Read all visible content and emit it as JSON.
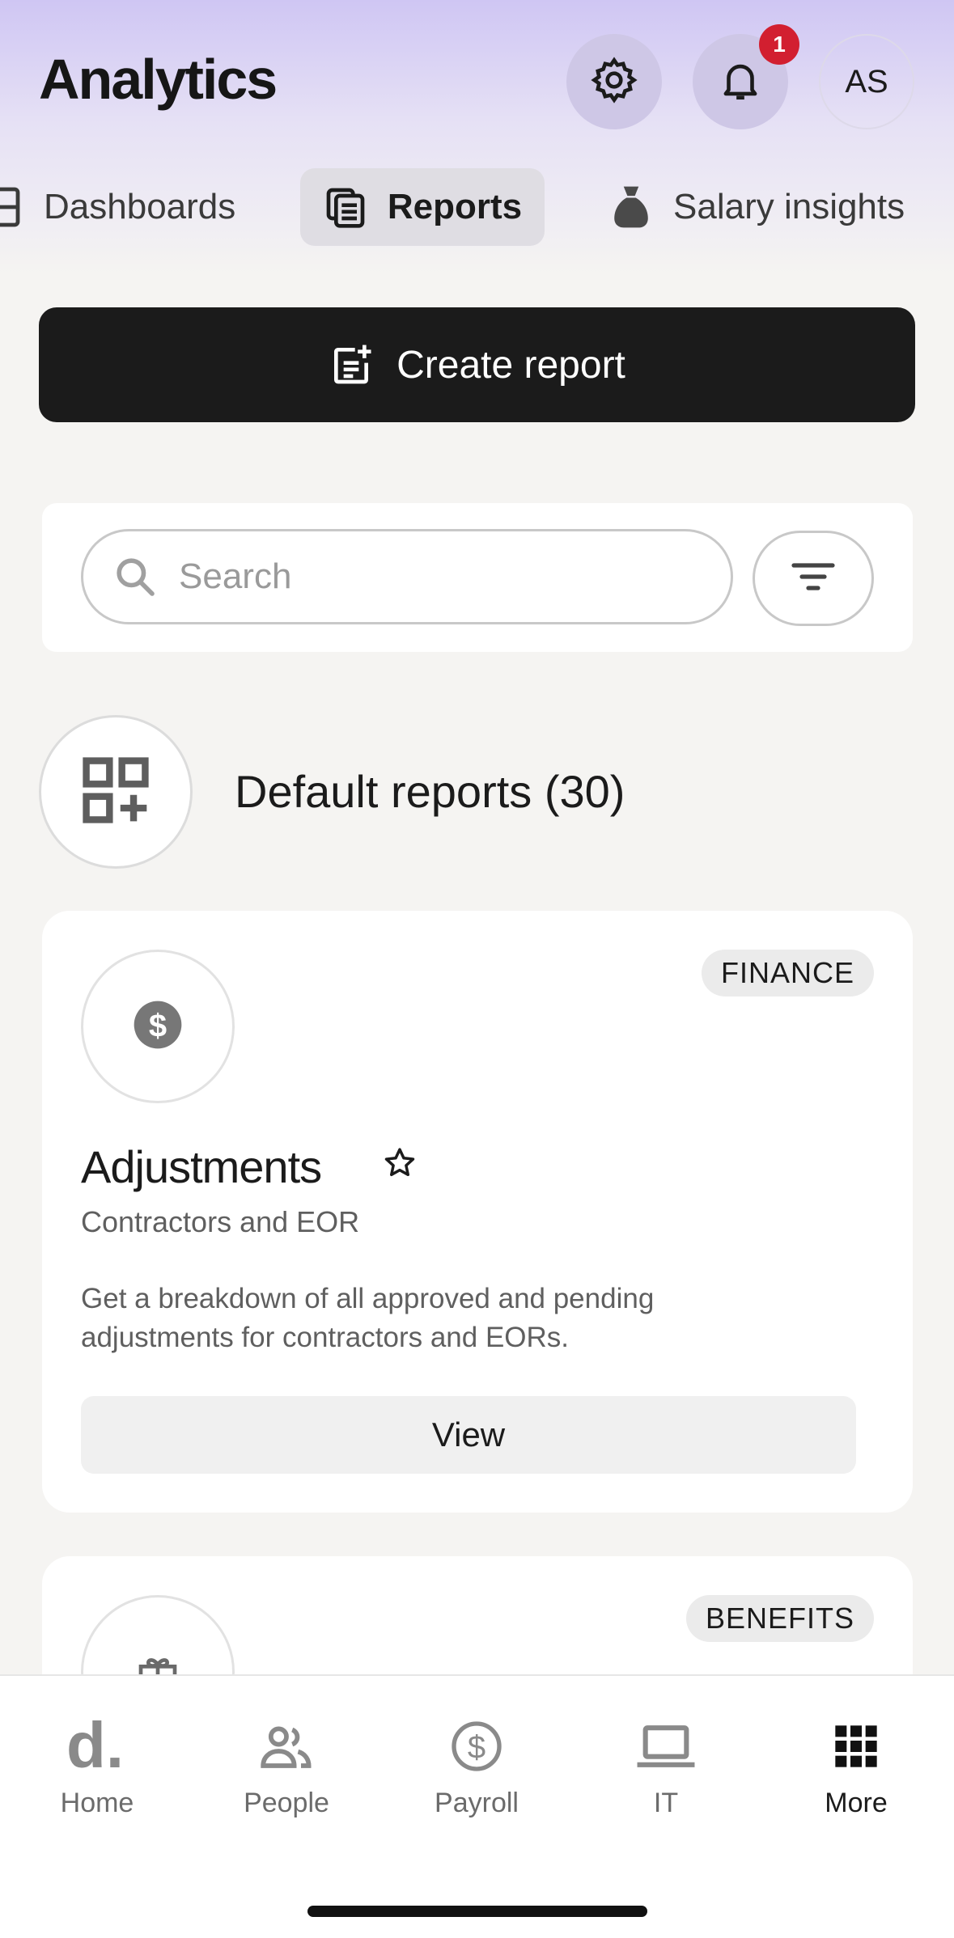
{
  "header": {
    "title": "Analytics",
    "notification_count": "1",
    "avatar_initials": "AS"
  },
  "tabs": [
    {
      "label": "Dashboards",
      "icon": "dashboard-icon"
    },
    {
      "label": "Reports",
      "icon": "reports-icon",
      "selected": true
    },
    {
      "label": "Salary insights",
      "icon": "money-bag-icon"
    }
  ],
  "create_button": {
    "label": "Create report",
    "icon": "add-document-icon"
  },
  "search": {
    "placeholder": "Search",
    "value": ""
  },
  "section": {
    "title": "Default reports (30)",
    "icon": "apps-add-icon"
  },
  "cards": [
    {
      "tag": "FINANCE",
      "icon": "dollar-icon",
      "title": "Adjustments",
      "subtitle": "Contractors and EOR",
      "description": "Get a breakdown of all approved and pending adjustments for contractors and EORs.",
      "button": "View"
    },
    {
      "tag": "BENEFITS",
      "icon": "gift-icon"
    }
  ],
  "bottom_nav": [
    {
      "label": "Home",
      "icon": "home-logo-icon"
    },
    {
      "label": "People",
      "icon": "people-icon"
    },
    {
      "label": "Payroll",
      "icon": "payroll-icon"
    },
    {
      "label": "IT",
      "icon": "laptop-icon"
    },
    {
      "label": "More",
      "icon": "grid-icon",
      "active": true
    }
  ],
  "colors": {
    "accent_gradient_top": "#cfc6f3",
    "primary_button": "#1b1b1b",
    "badge": "#d21f30",
    "background": "#f5f4f2"
  }
}
